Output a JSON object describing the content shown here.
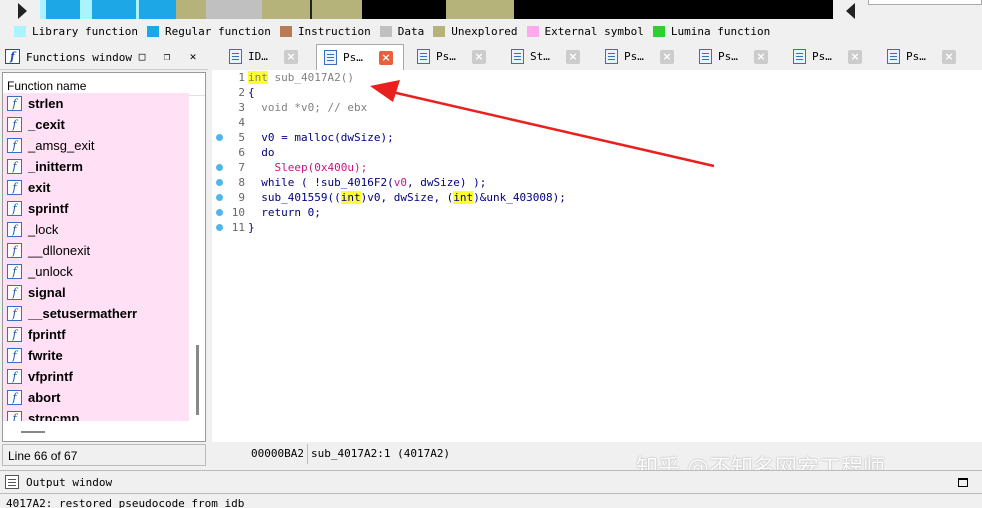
{
  "legend": [
    {
      "label": "Library function",
      "color": "#aaf4ff"
    },
    {
      "label": "Regular function",
      "color": "#1ea7e6"
    },
    {
      "label": "Instruction",
      "color": "#b97a57"
    },
    {
      "label": "Data",
      "color": "#c0c0c0"
    },
    {
      "label": "Unexplored",
      "color": "#b5b27a"
    },
    {
      "label": "External symbol",
      "color": "#ffaaee"
    },
    {
      "label": "Lumina function",
      "color": "#2fcf2f"
    }
  ],
  "functions_window": {
    "title": "Functions window",
    "column_header": "Function name",
    "items": [
      {
        "name": "strlen",
        "bold": true
      },
      {
        "name": "_cexit",
        "bold": true
      },
      {
        "name": "_amsg_exit",
        "bold": false
      },
      {
        "name": "_initterm",
        "bold": true
      },
      {
        "name": "exit",
        "bold": true
      },
      {
        "name": "sprintf",
        "bold": true
      },
      {
        "name": "_lock",
        "bold": false
      },
      {
        "name": "__dllonexit",
        "bold": false
      },
      {
        "name": "_unlock",
        "bold": false
      },
      {
        "name": "signal",
        "bold": true
      },
      {
        "name": "__setusermatherr",
        "bold": true
      },
      {
        "name": "fprintf",
        "bold": true
      },
      {
        "name": "fwrite",
        "bold": true
      },
      {
        "name": "vfprintf",
        "bold": true
      },
      {
        "name": "abort",
        "bold": true
      },
      {
        "name": "strncmp",
        "bold": true
      }
    ],
    "status": "Line 66 of 67"
  },
  "tabs": [
    {
      "label": "ID…",
      "active": false
    },
    {
      "label": "Ps…",
      "active": true
    },
    {
      "label": "Ps…",
      "active": false
    },
    {
      "label": "St…",
      "active": false
    },
    {
      "label": "Ps…",
      "active": false
    },
    {
      "label": "Ps…",
      "active": false
    },
    {
      "label": "Ps…",
      "active": false
    },
    {
      "label": "Ps…",
      "active": false
    }
  ],
  "code": {
    "lines": [
      {
        "n": "1",
        "dot": false
      },
      {
        "n": "2",
        "dot": false
      },
      {
        "n": "3",
        "dot": false
      },
      {
        "n": "4",
        "dot": false
      },
      {
        "n": "5",
        "dot": true
      },
      {
        "n": "6",
        "dot": false
      },
      {
        "n": "7",
        "dot": true
      },
      {
        "n": "8",
        "dot": true
      },
      {
        "n": "9",
        "dot": true
      },
      {
        "n": "10",
        "dot": true
      },
      {
        "n": "11",
        "dot": true
      }
    ],
    "tokens": {
      "l1_int": "int",
      "l1_rest": " sub_4017A2()",
      "l2": "{",
      "l3": "  void *v0; // ebx",
      "l5": "  v0 = malloc(dwSize);",
      "l6": "  do",
      "l7": "    Sleep(0x400u);",
      "l8_a": "  while ( !sub_4016F2(",
      "l8_b": "v0",
      "l8_c": ", dwSize) );",
      "l9_a": "  sub_401559((",
      "l9_int1": "int",
      "l9_b": ")v0, dwSize, (",
      "l9_int2": "int",
      "l9_c": ")&unk_403008);",
      "l10": "  return 0;",
      "l11": "}"
    },
    "status_address": "00000BA2",
    "status_location": "sub_4017A2:1 (4017A2)"
  },
  "watermark": "知乎 @不知名网安工程师",
  "output_window": {
    "title": "Output window",
    "text": "4017A2: restored pseudocode from idb"
  },
  "colors": {
    "arrow": "#e8201e",
    "highlight": "#ffff33",
    "external_bg": "#ffe0f4",
    "active_tab_close": "#e8613c"
  }
}
